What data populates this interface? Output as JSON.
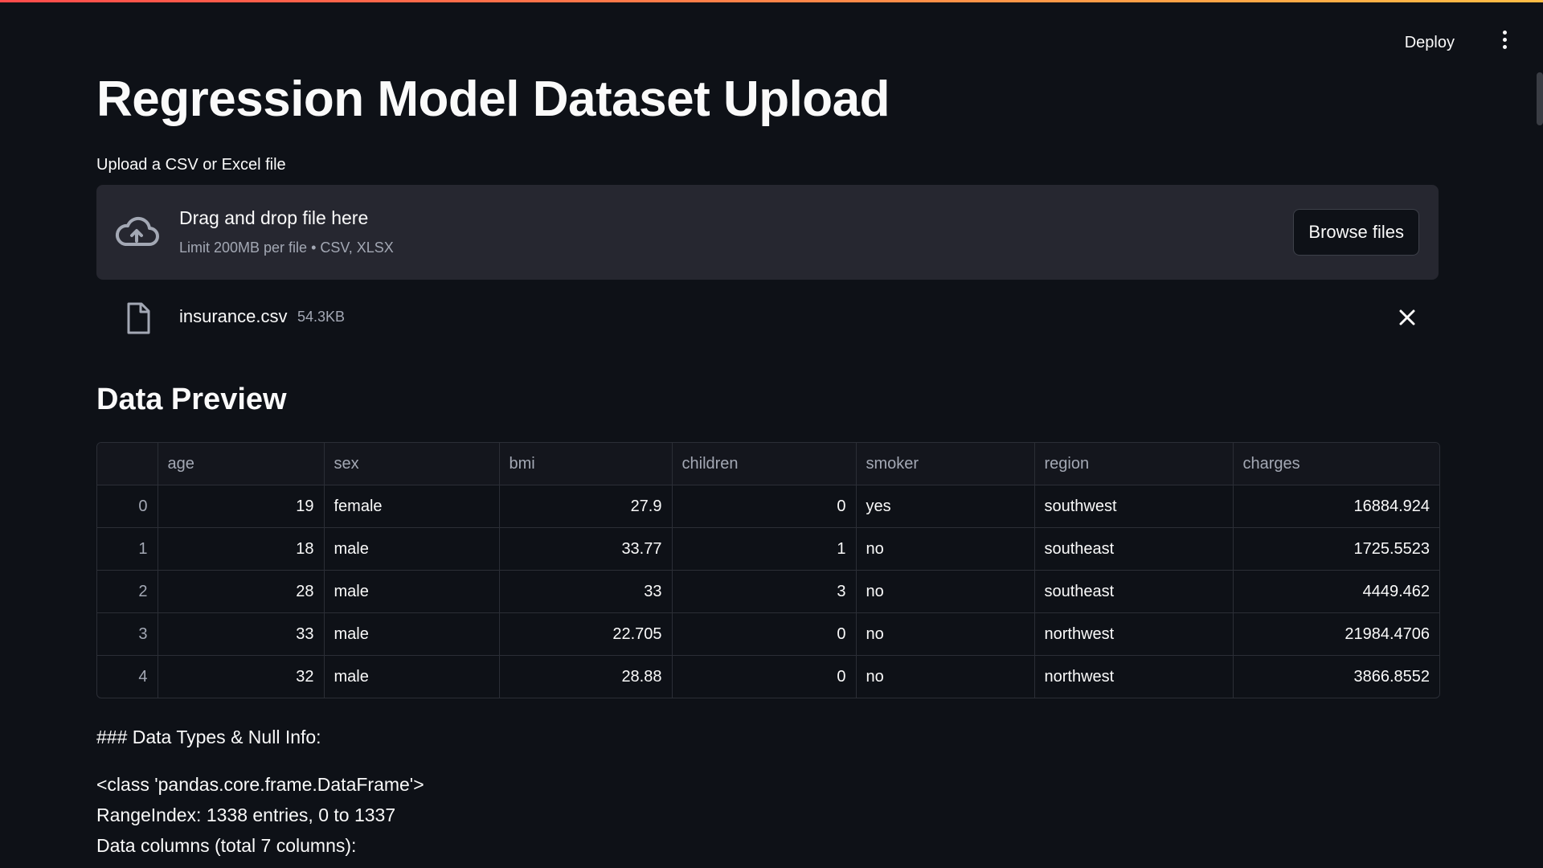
{
  "app": {
    "deploy_label": "Deploy",
    "accent_gradient": [
      "#ff4b4b",
      "#ffbd45"
    ],
    "background": "#0e1117"
  },
  "page": {
    "title": "Regression Model Dataset Upload"
  },
  "uploader": {
    "label": "Upload a CSV or Excel file",
    "drop_title": "Drag and drop file here",
    "drop_subtitle": "Limit 200MB per file • CSV, XLSX",
    "browse_label": "Browse files",
    "icon": "cloud-upload-icon"
  },
  "uploaded_file": {
    "name": "insurance.csv",
    "size": "54.3KB",
    "icon": "file-icon"
  },
  "preview": {
    "heading": "Data Preview",
    "columns": [
      "",
      "age",
      "sex",
      "bmi",
      "children",
      "smoker",
      "region",
      "charges"
    ],
    "rows": [
      [
        "0",
        "19",
        "female",
        "27.9",
        "0",
        "yes",
        "southwest",
        "16884.924"
      ],
      [
        "1",
        "18",
        "male",
        "33.77",
        "1",
        "no",
        "southeast",
        "1725.5523"
      ],
      [
        "2",
        "28",
        "male",
        "33",
        "3",
        "no",
        "southeast",
        "4449.462"
      ],
      [
        "3",
        "33",
        "male",
        "22.705",
        "0",
        "no",
        "northwest",
        "21984.4706"
      ],
      [
        "4",
        "32",
        "male",
        "28.88",
        "0",
        "no",
        "northwest",
        "3866.8552"
      ]
    ]
  },
  "info": {
    "heading": "### Data Types & Null Info:",
    "lines": [
      "<class 'pandas.core.frame.DataFrame'>",
      "RangeIndex: 1338 entries, 0 to 1337",
      "Data columns (total 7 columns):"
    ]
  }
}
